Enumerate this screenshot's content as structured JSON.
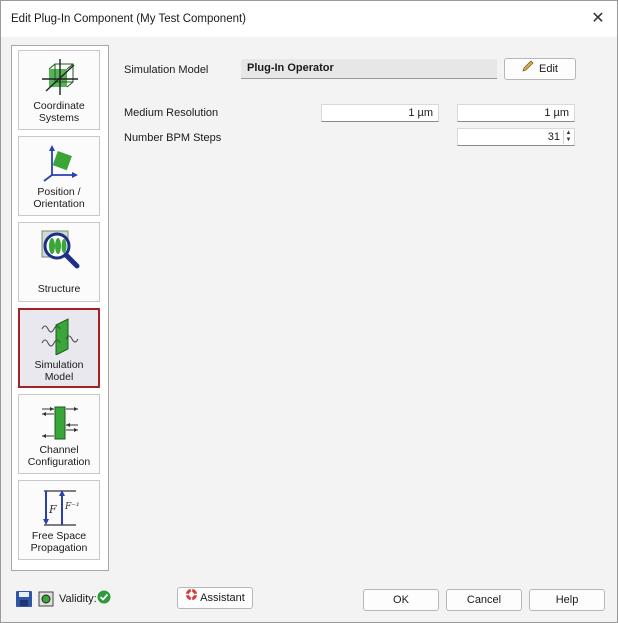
{
  "window": {
    "title": "Edit Plug-In Component (My Test Component)",
    "close_glyph": "✕"
  },
  "sidebar": {
    "items": [
      {
        "label": "Coordinate Systems",
        "icon": "coordinate-systems-icon"
      },
      {
        "label": "Position / Orientation",
        "icon": "position-orientation-icon"
      },
      {
        "label": "Structure",
        "icon": "structure-icon"
      },
      {
        "label": "Simulation Model",
        "icon": "simulation-model-icon",
        "selected": true
      },
      {
        "label": "Channel Configuration",
        "icon": "channel-configuration-icon"
      },
      {
        "label": "Free Space Propagation",
        "icon": "free-space-propagation-icon"
      }
    ]
  },
  "main": {
    "simulation_model_label": "Simulation Model",
    "simulation_model_value": "Plug-In Operator",
    "edit_button_label": "Edit",
    "medium_resolution_label": "Medium Resolution",
    "medium_resolution_x": "1 µm",
    "medium_resolution_y": "1 µm",
    "bpm_steps_label": "Number BPM Steps",
    "bpm_steps_value": "31"
  },
  "footer": {
    "validity_label": "Validity:",
    "assistant_label": "Assistant",
    "ok_label": "OK",
    "cancel_label": "Cancel",
    "help_label": "Help"
  },
  "colors": {
    "selected_border": "#a32228",
    "icon_green": "#3aa63a",
    "validity_green": "#2e9a3a"
  }
}
